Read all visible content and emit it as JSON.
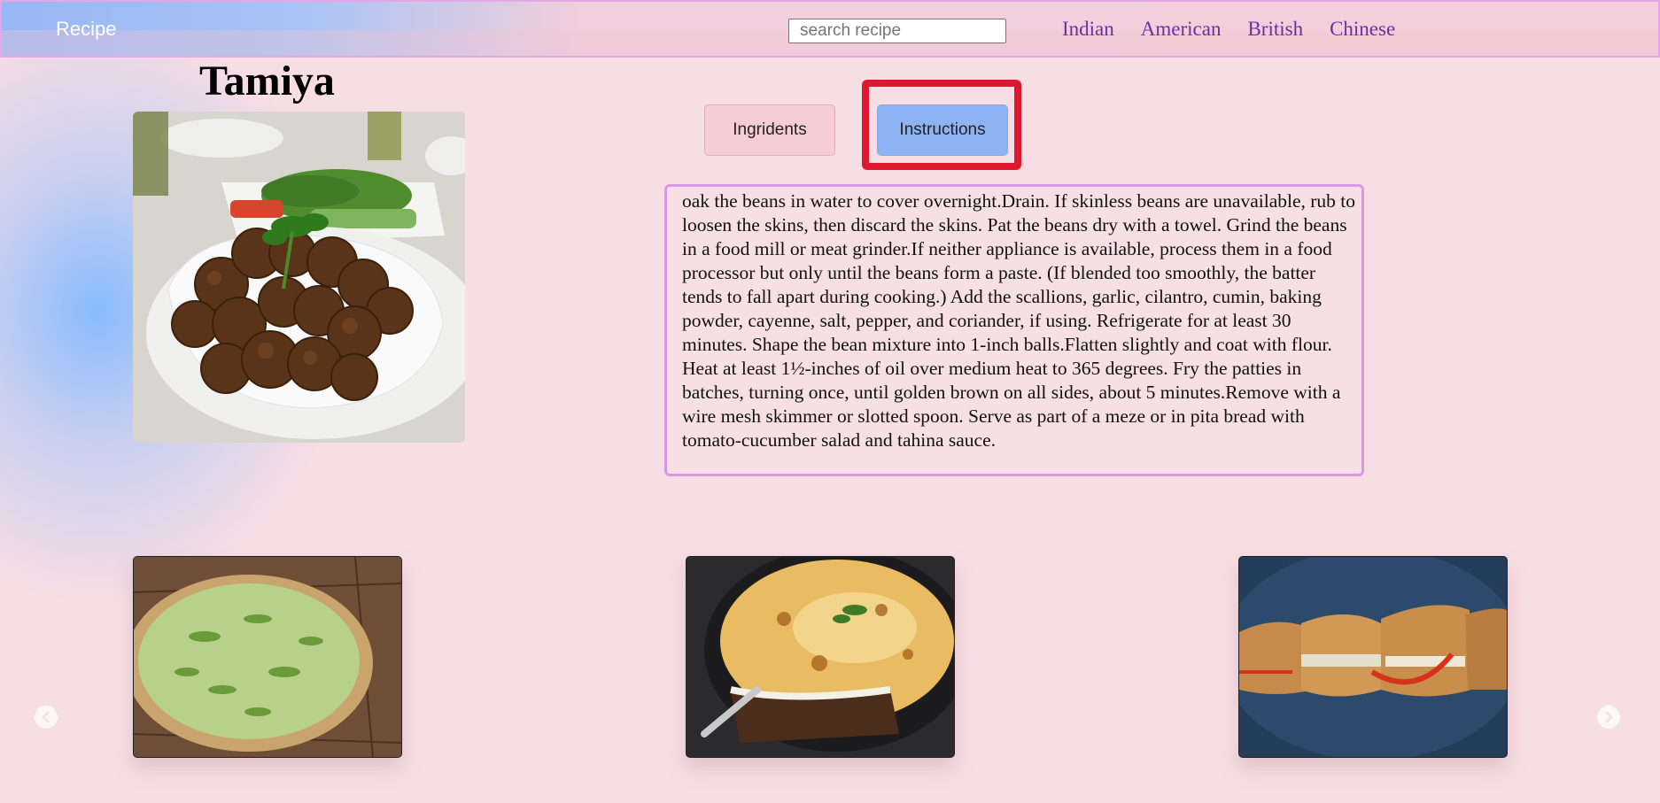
{
  "navbar": {
    "brand": "Recipe",
    "search_placeholder": "search recipe",
    "links": [
      "Indian",
      "American",
      "British",
      "Chinese"
    ]
  },
  "recipe": {
    "title": "Tamiya",
    "image_icon": "falafel-photo"
  },
  "tabs": {
    "ingredients_label": "Ingridents",
    "instructions_label": "Instructions",
    "active": "instructions"
  },
  "instructions": {
    "text": "oak the beans in water to cover overnight.Drain. If skinless beans are unavailable, rub to loosen the skins, then discard the skins. Pat the beans dry with a towel. Grind the beans in a food mill or meat grinder.If neither appliance is available, process them in a food processor but only until the beans form a paste. (If blended too smoothly, the batter tends to fall apart during cooking.) Add the scallions, garlic, cilantro, cumin, baking powder, cayenne, salt, pepper, and coriander, if using. Refrigerate for at least 30 minutes. Shape the bean mixture into 1-inch balls.Flatten slightly and coat with flour. Heat at least 1½-inches of oil over medium heat to 365 degrees. Fry the patties in batches, turning once, until golden brown on all sides, about 5 minutes.Remove with a wire mesh skimmer or slotted spoon. Serve as part of a meze or in pita bread with tomato-cucumber salad and tahina sauce."
  },
  "carousel": {
    "items": [
      {
        "icon": "quiche-photo"
      },
      {
        "icon": "moussaka-photo"
      },
      {
        "icon": "sandwich-photo"
      }
    ],
    "prev_icon": "chevron-left-icon",
    "next_icon": "chevron-right-icon"
  },
  "colors": {
    "background": "#f7dde4",
    "nav_link": "#6a2fa3",
    "active_tab": "#8db3f2",
    "inactive_tab": "#f5ccd8",
    "highlight": "#e0182f",
    "panel_border": "#d998e6"
  }
}
